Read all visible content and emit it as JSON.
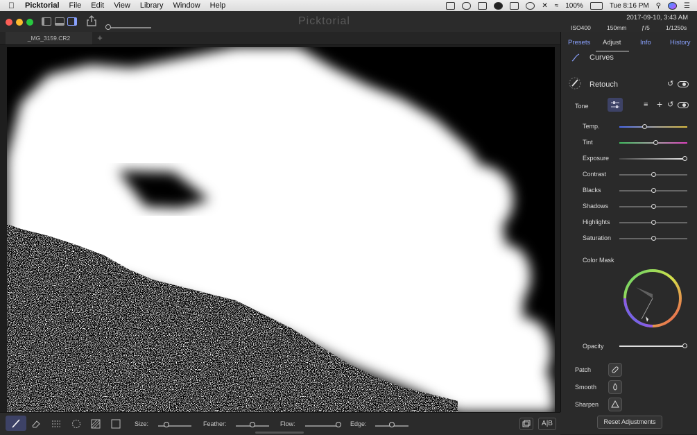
{
  "menubar": {
    "app_name": "Picktorial",
    "items": [
      "File",
      "Edit",
      "View",
      "Library",
      "Window",
      "Help"
    ],
    "battery": "100%",
    "clock": "Tue 8:16 PM"
  },
  "window": {
    "title": "Picktorial",
    "tab_name": "_MG_3159.CR2",
    "add_tab": "+"
  },
  "exif": {
    "datetime": "2017-09-10, 3:43 AM",
    "iso": "ISO400",
    "focal": "150mm",
    "aperture": "ƒ/5",
    "shutter": "1/1250s"
  },
  "panel": {
    "tabs": [
      "Presets",
      "Adjust",
      "Info",
      "History"
    ],
    "active_tab": "Adjust",
    "curves_label": "Curves",
    "retouch_label": "Retouch",
    "tone_label": "Tone",
    "sliders": [
      {
        "label": "Temp.",
        "value": 0.36
      },
      {
        "label": "Tint",
        "value": 0.54
      },
      {
        "label": "Exposure",
        "value": 1.0
      },
      {
        "label": "Contrast",
        "value": 0.5
      },
      {
        "label": "Blacks",
        "value": 0.5
      },
      {
        "label": "Shadows",
        "value": 0.5
      },
      {
        "label": "Highlights",
        "value": 0.5
      },
      {
        "label": "Saturation",
        "value": 0.5
      }
    ],
    "color_mask_label": "Color Mask",
    "opacity_label": "Opacity",
    "opacity_value": 1.0,
    "tools": [
      "Patch",
      "Smooth",
      "Sharpen"
    ],
    "reset_label": "Reset Adjustments"
  },
  "bottombar": {
    "size_label": "Size:",
    "size_value": 0.25,
    "feather_label": "Feather:",
    "feather_value": 0.5,
    "flow_label": "Flow:",
    "flow_value": 1.0,
    "edge_label": "Edge:",
    "edge_value": 0.5,
    "ab_label": "A|B"
  }
}
